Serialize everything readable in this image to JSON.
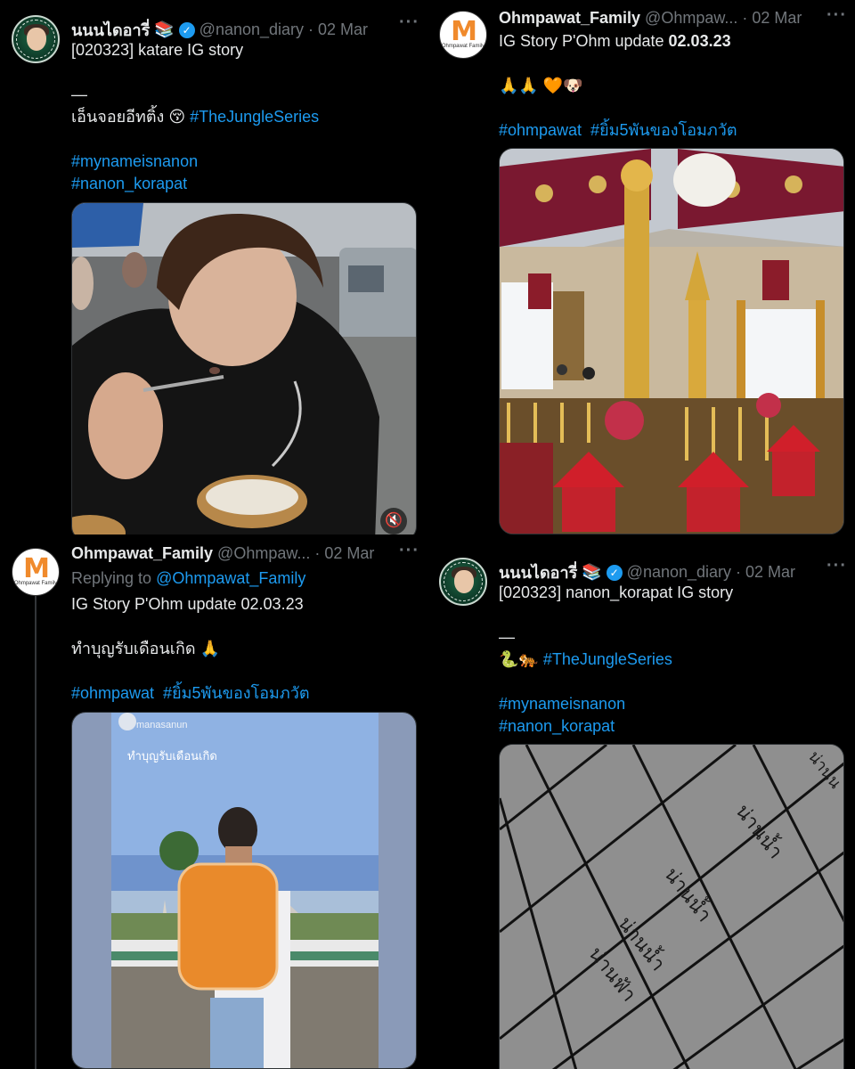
{
  "tweets": [
    {
      "user": {
        "name": "นนนไดอารี่",
        "emoji": "📚",
        "handle": "@nanon_diary",
        "date": "02 Mar"
      },
      "lines": [
        {
          "text": "[020323] katare IG story"
        },
        {
          "text": ""
        },
        {
          "text": "—"
        },
        {
          "text": "เอ็นจอยอีทติ้ง 😚 ",
          "hashtag": "#TheJungleSeries"
        },
        {
          "text": ""
        },
        {
          "hashtag": "#mynameisnanon"
        },
        {
          "hashtag": "#nanon_korapat"
        }
      ],
      "media": {
        "icon": "volume-mute-icon",
        "glyph": "🔇"
      }
    },
    {
      "user": {
        "name": "Ohmpawat_Family",
        "handle": "@Ohmpaw...",
        "date": "02 Mar"
      },
      "lines": [
        {
          "text": "IG Story P'Ohm update ",
          "bold": "02.03.23"
        },
        {
          "text": ""
        },
        {
          "text": "🙏🙏 🧡🐶"
        },
        {
          "text": ""
        },
        {
          "hashtag": "#ohmpawat  #ยิ้ม5พันของโอมภวัต"
        }
      ]
    },
    {
      "user": {
        "name": "Ohmpawat_Family",
        "handle": "@Ohmpaw...",
        "date": "02 Mar"
      },
      "replying_to": {
        "prefix": "Replying to ",
        "handle": "@Ohmpawat_Family"
      },
      "lines": [
        {
          "text": "IG Story P'Ohm update 02.03.23"
        },
        {
          "text": ""
        },
        {
          "text": "ทำบุญรับเดือนเกิด 🙏"
        },
        {
          "text": ""
        },
        {
          "hashtag": "#ohmpawat  #ยิ้ม5พันของโอมภวัต"
        }
      ],
      "story": {
        "username": "manasanun",
        "caption": "ทำบุญรับเดือนเกิด"
      }
    },
    {
      "user": {
        "name": "นนนไดอารี่",
        "emoji": "📚",
        "handle": "@nanon_diary",
        "date": "02 Mar"
      },
      "lines": [
        {
          "text": "[020323] nanon_korapat IG story"
        },
        {
          "text": ""
        },
        {
          "text": "—"
        },
        {
          "text": "🐍🐅 ",
          "hashtag": "#TheJungleSeries"
        },
        {
          "text": ""
        },
        {
          "hashtag": "#mynameisnanon"
        },
        {
          "hashtag": "#nanon_korapat"
        }
      ],
      "tiles": [
        "น่านน้ำ",
        "น่านน้ำ",
        "น่านน้ำ",
        "น่านฟ้า",
        "น่านน"
      ]
    }
  ],
  "ui": {
    "more": "···",
    "verified_glyph": "✓",
    "avatar_ohm_letter": "M",
    "avatar_ohm_caption": "Ohmpawat Family"
  }
}
